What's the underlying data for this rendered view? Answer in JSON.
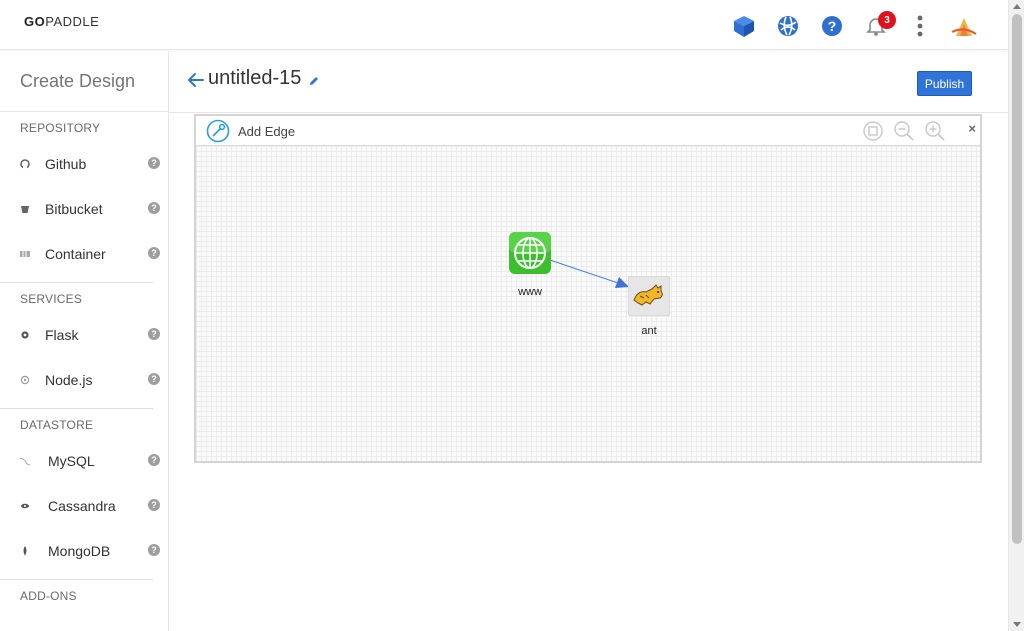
{
  "app": {
    "logo_bold": "GO",
    "logo_rest": "PADDLE",
    "notification_count": "3"
  },
  "sidebar": {
    "title": "Create Design",
    "sections": [
      {
        "header": "REPOSITORY",
        "items": [
          {
            "label": "Github",
            "icon": "github-icon"
          },
          {
            "label": "Bitbucket",
            "icon": "bitbucket-icon"
          },
          {
            "label": "Container",
            "icon": "container-icon"
          }
        ]
      },
      {
        "header": "SERVICES",
        "items": [
          {
            "label": "Flask",
            "icon": "flask-icon"
          },
          {
            "label": "Node.js",
            "icon": "nodejs-icon"
          }
        ]
      },
      {
        "header": "DATASTORE",
        "items": [
          {
            "label": "MySQL",
            "icon": "mysql-icon"
          },
          {
            "label": "Cassandra",
            "icon": "cassandra-icon"
          },
          {
            "label": "MongoDB",
            "icon": "mongodb-icon"
          }
        ]
      },
      {
        "header": "ADD-ONS",
        "items": []
      }
    ],
    "help_glyph": "?"
  },
  "design": {
    "title": "untitled-15",
    "publish_label": "Publish"
  },
  "canvas": {
    "add_edge_label": "Add Edge",
    "close_glyph": "×",
    "nodes": [
      {
        "label": "www",
        "icon": "globe-icon"
      },
      {
        "label": "ant",
        "icon": "tomcat-icon"
      }
    ]
  },
  "colors": {
    "accent": "#2f74d9",
    "badge": "#e0101f",
    "globe_green": "#3cbf2c"
  }
}
